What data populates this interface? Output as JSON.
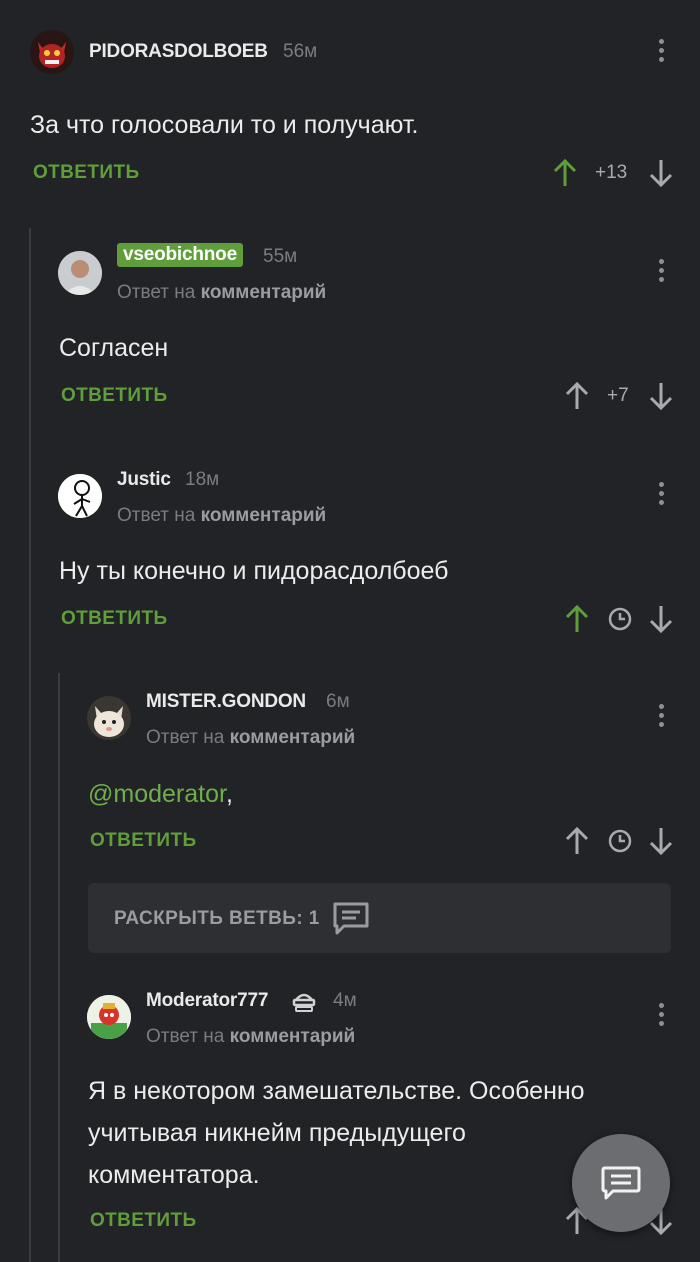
{
  "comments": [
    {
      "author": "PIDORASDOLBOEB",
      "time": "56м",
      "text": "За что голосовали то и получают.",
      "reply": "ОТВЕТИТЬ",
      "score": "+13",
      "upvoted": true
    },
    {
      "author": "vseobichnoe",
      "time": "55м",
      "reply_prefix": "Ответ на",
      "reply_target": "комментарий",
      "text": "Согласен",
      "reply": "ОТВЕТИТЬ",
      "score": "+7",
      "upvoted": false
    },
    {
      "author": "Justic",
      "time": "18м",
      "reply_prefix": "Ответ на",
      "reply_target": "комментарий",
      "text": "Ну ты конечно и пидорасдолбоеб",
      "reply": "ОТВЕТИТЬ",
      "score_icon": "clock-icon",
      "upvoted": true
    },
    {
      "author": "MISTER.GONDON",
      "time": "6м",
      "reply_prefix": "Ответ на",
      "reply_target": "комментарий",
      "mention": "@moderator",
      "text_suffix": ",",
      "reply": "ОТВЕТИТЬ",
      "score_icon": "clock-icon",
      "upvoted": false
    },
    {
      "author": "Moderator777",
      "time": "4м",
      "reply_prefix": "Ответ на",
      "reply_target": "комментарий",
      "text_lines": [
        "Я в некотором замешательстве. Особенно",
        "учитывая никнейм предыдущего",
        "комментатора."
      ],
      "reply": "ОТВЕТИТЬ"
    }
  ],
  "expand_branch": {
    "label": "РАСКРЫТЬ ВЕТВЬ: 1",
    "icon": "comments-icon"
  },
  "fab": {
    "icon": "comment-compose-icon"
  },
  "colors": {
    "background": "#212326",
    "accent_green": "#5f9e3b",
    "muted": "#7a7c80"
  }
}
